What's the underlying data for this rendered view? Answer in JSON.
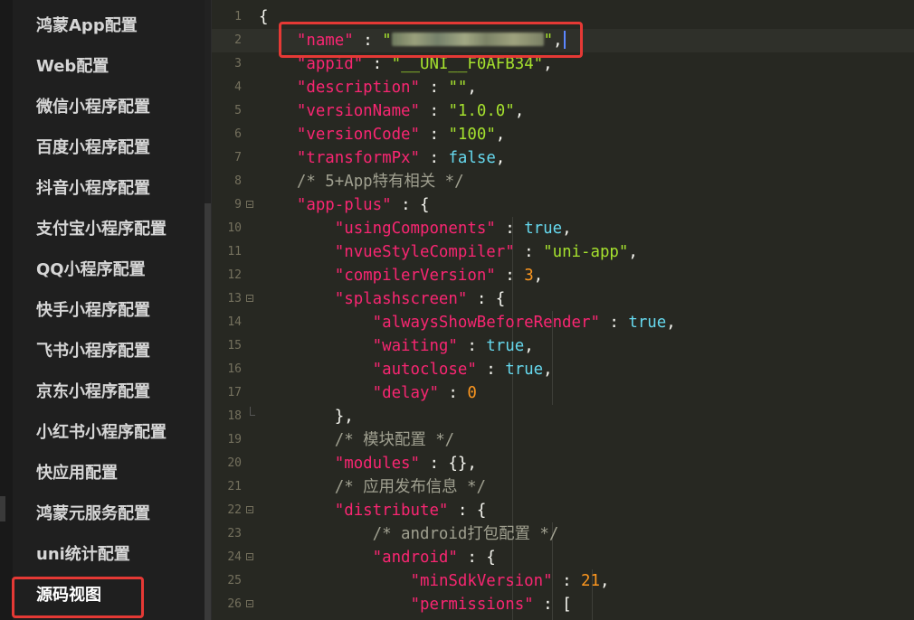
{
  "sidebar": {
    "items": [
      {
        "label": "鸿蒙App配置"
      },
      {
        "label": "Web配置"
      },
      {
        "label": "微信小程序配置"
      },
      {
        "label": "百度小程序配置"
      },
      {
        "label": "抖音小程序配置"
      },
      {
        "label": "支付宝小程序配置"
      },
      {
        "label": "QQ小程序配置"
      },
      {
        "label": "快手小程序配置"
      },
      {
        "label": "飞书小程序配置"
      },
      {
        "label": "京东小程序配置"
      },
      {
        "label": "小红书小程序配置"
      },
      {
        "label": "快应用配置"
      },
      {
        "label": "鸿蒙元服务配置"
      },
      {
        "label": "uni统计配置"
      },
      {
        "label": "源码视图",
        "active": true
      }
    ]
  },
  "editor": {
    "current_line": 2,
    "lines": [
      {
        "n": "1",
        "tokens": [
          [
            "p",
            "{"
          ]
        ]
      },
      {
        "n": "2",
        "tokens": [
          [
            "p",
            "    "
          ],
          [
            "k",
            "\"name\""
          ],
          [
            "p",
            " : "
          ],
          [
            "s",
            "\""
          ],
          [
            "blur",
            ""
          ],
          [
            "s",
            "\""
          ],
          [
            "p",
            ","
          ],
          [
            "caret",
            ""
          ]
        ]
      },
      {
        "n": "3",
        "tokens": [
          [
            "p",
            "    "
          ],
          [
            "k",
            "\"appid\""
          ],
          [
            "p",
            " : "
          ],
          [
            "s",
            "\"__UNI__F0AFB34\""
          ],
          [
            "p",
            ","
          ]
        ]
      },
      {
        "n": "4",
        "tokens": [
          [
            "p",
            "    "
          ],
          [
            "k",
            "\"description\""
          ],
          [
            "p",
            " : "
          ],
          [
            "s",
            "\"\""
          ],
          [
            "p",
            ","
          ]
        ]
      },
      {
        "n": "5",
        "tokens": [
          [
            "p",
            "    "
          ],
          [
            "k",
            "\"versionName\""
          ],
          [
            "p",
            " : "
          ],
          [
            "s",
            "\"1.0.0\""
          ],
          [
            "p",
            ","
          ]
        ]
      },
      {
        "n": "6",
        "tokens": [
          [
            "p",
            "    "
          ],
          [
            "k",
            "\"versionCode\""
          ],
          [
            "p",
            " : "
          ],
          [
            "s",
            "\"100\""
          ],
          [
            "p",
            ","
          ]
        ]
      },
      {
        "n": "7",
        "tokens": [
          [
            "p",
            "    "
          ],
          [
            "k",
            "\"transformPx\""
          ],
          [
            "p",
            " : "
          ],
          [
            "b",
            "false"
          ],
          [
            "p",
            ","
          ]
        ]
      },
      {
        "n": "8",
        "tokens": [
          [
            "p",
            "    "
          ],
          [
            "c",
            "/* 5+App特有相关 */"
          ]
        ]
      },
      {
        "n": "9",
        "fold": true,
        "tokens": [
          [
            "p",
            "    "
          ],
          [
            "k",
            "\"app-plus\""
          ],
          [
            "p",
            " : {"
          ]
        ]
      },
      {
        "n": "10",
        "tokens": [
          [
            "p",
            "        "
          ],
          [
            "k",
            "\"usingComponents\""
          ],
          [
            "p",
            " : "
          ],
          [
            "b",
            "true"
          ],
          [
            "p",
            ","
          ]
        ]
      },
      {
        "n": "11",
        "tokens": [
          [
            "p",
            "        "
          ],
          [
            "k",
            "\"nvueStyleCompiler\""
          ],
          [
            "p",
            " : "
          ],
          [
            "s",
            "\"uni-app\""
          ],
          [
            "p",
            ","
          ]
        ]
      },
      {
        "n": "12",
        "tokens": [
          [
            "p",
            "        "
          ],
          [
            "k",
            "\"compilerVersion\""
          ],
          [
            "p",
            " : "
          ],
          [
            "n",
            "3"
          ],
          [
            "p",
            ","
          ]
        ]
      },
      {
        "n": "13",
        "fold": true,
        "tokens": [
          [
            "p",
            "        "
          ],
          [
            "k",
            "\"splashscreen\""
          ],
          [
            "p",
            " : {"
          ]
        ]
      },
      {
        "n": "14",
        "tokens": [
          [
            "p",
            "            "
          ],
          [
            "k",
            "\"alwaysShowBeforeRender\""
          ],
          [
            "p",
            " : "
          ],
          [
            "b",
            "true"
          ],
          [
            "p",
            ","
          ]
        ]
      },
      {
        "n": "15",
        "tokens": [
          [
            "p",
            "            "
          ],
          [
            "k",
            "\"waiting\""
          ],
          [
            "p",
            " : "
          ],
          [
            "b",
            "true"
          ],
          [
            "p",
            ","
          ]
        ]
      },
      {
        "n": "16",
        "tokens": [
          [
            "p",
            "            "
          ],
          [
            "k",
            "\"autoclose\""
          ],
          [
            "p",
            " : "
          ],
          [
            "b",
            "true"
          ],
          [
            "p",
            ","
          ]
        ]
      },
      {
        "n": "17",
        "tokens": [
          [
            "p",
            "            "
          ],
          [
            "k",
            "\"delay\""
          ],
          [
            "p",
            " : "
          ],
          [
            "n",
            "0"
          ]
        ]
      },
      {
        "n": "18",
        "foldEnd": true,
        "tokens": [
          [
            "p",
            "        },"
          ]
        ]
      },
      {
        "n": "19",
        "tokens": [
          [
            "p",
            "        "
          ],
          [
            "c",
            "/* 模块配置 */"
          ]
        ]
      },
      {
        "n": "20",
        "tokens": [
          [
            "p",
            "        "
          ],
          [
            "k",
            "\"modules\""
          ],
          [
            "p",
            " : {},"
          ]
        ]
      },
      {
        "n": "21",
        "tokens": [
          [
            "p",
            "        "
          ],
          [
            "c",
            "/* 应用发布信息 */"
          ]
        ]
      },
      {
        "n": "22",
        "fold": true,
        "tokens": [
          [
            "p",
            "        "
          ],
          [
            "k",
            "\"distribute\""
          ],
          [
            "p",
            " : {"
          ]
        ]
      },
      {
        "n": "23",
        "tokens": [
          [
            "p",
            "            "
          ],
          [
            "c",
            "/* android打包配置 */"
          ]
        ]
      },
      {
        "n": "24",
        "fold": true,
        "tokens": [
          [
            "p",
            "            "
          ],
          [
            "k",
            "\"android\""
          ],
          [
            "p",
            " : {"
          ]
        ]
      },
      {
        "n": "25",
        "tokens": [
          [
            "p",
            "                "
          ],
          [
            "k",
            "\"minSdkVersion\""
          ],
          [
            "p",
            " : "
          ],
          [
            "n",
            "21"
          ],
          [
            "p",
            ","
          ]
        ]
      },
      {
        "n": "26",
        "fold": true,
        "tokens": [
          [
            "p",
            "                "
          ],
          [
            "k",
            "\"permissions\""
          ],
          [
            "p",
            " : ["
          ]
        ]
      }
    ]
  },
  "colors": {
    "highlight": "#e53935",
    "key": "#f92672",
    "string": "#a6e22e",
    "boolean": "#66d9ef",
    "number": "#fd971f",
    "comment": "#a0a090"
  }
}
